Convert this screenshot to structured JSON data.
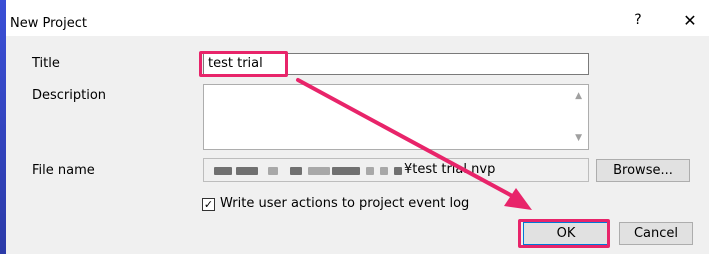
{
  "window": {
    "title": "New Project",
    "help_label": "?",
    "close_label": "✕"
  },
  "form": {
    "title_label": "Title",
    "title_value": "test trial",
    "description_label": "Description",
    "description_value": "",
    "file_name_label": "File name",
    "file_name_suffix": "¥test trial.nvp",
    "browse_label": "Browse...",
    "checkbox_label": "Write user actions to project event log",
    "checkbox_checked": true
  },
  "buttons": {
    "ok_label": "OK",
    "cancel_label": "Cancel"
  },
  "annotation": {
    "color": "#e8246a"
  }
}
